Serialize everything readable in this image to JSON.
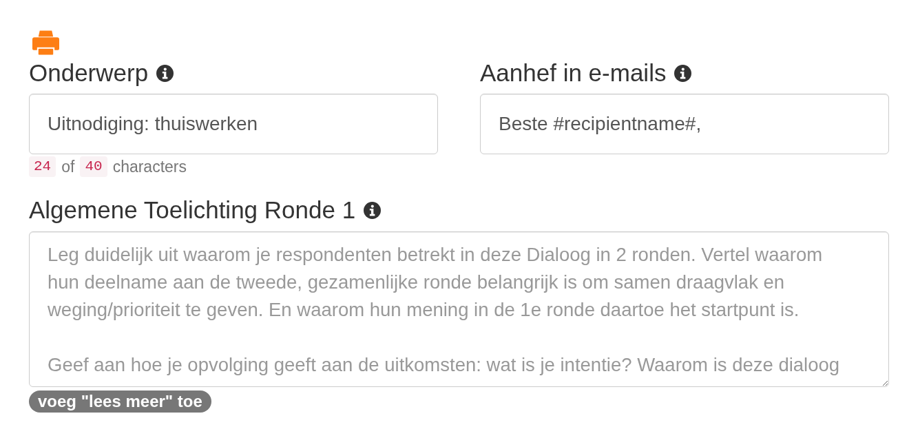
{
  "subject": {
    "label": "Onderwerp",
    "value": "Uitnodiging: thuiswerken",
    "counter": {
      "count": "24",
      "separator": "of",
      "limit": "40",
      "unit": "characters"
    }
  },
  "salutation": {
    "label": "Aanhef in e-mails",
    "value": "Beste #recipientname#,"
  },
  "explanation": {
    "label": "Algemene Toelichting Ronde 1",
    "placeholder": "Leg duidelijk uit waarom je respondenten betrekt in deze Dialoog in 2 ronden. Vertel waarom hun deelname aan de tweede, gezamenlijke ronde belangrijk is om samen draagvlak en weging/prioriteit te geven. En waarom hun mening in de 1e ronde daartoe het startpunt is.\n\nGeef aan hoe je opvolging geeft aan de uitkomsten: wat is je intentie? Waarom is deze dialoog",
    "action": "voeg \"lees meer\" toe"
  }
}
